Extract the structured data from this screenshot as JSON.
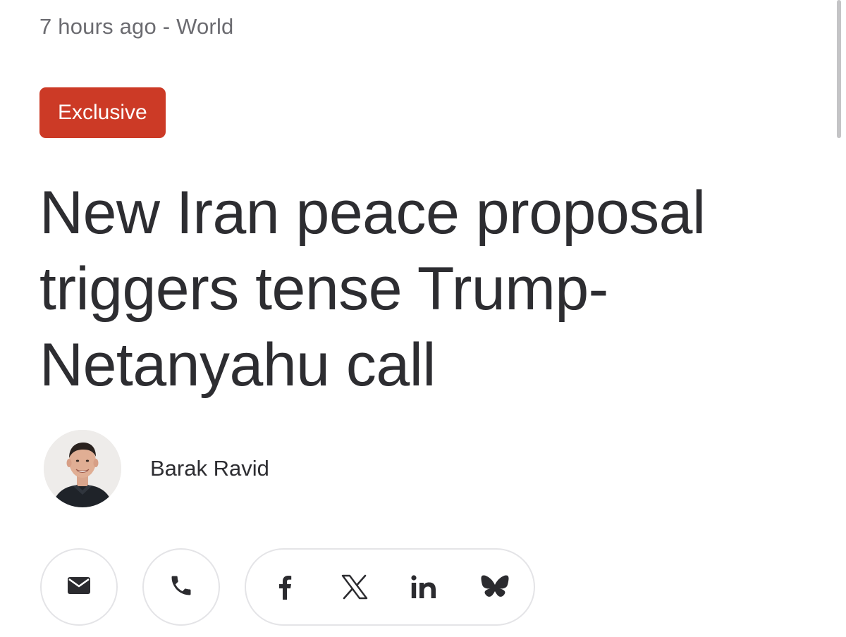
{
  "meta": {
    "time": "7 hours ago",
    "separator": " - ",
    "section": "World"
  },
  "badge": {
    "label": "Exclusive",
    "color": "#cc3a26"
  },
  "article": {
    "headline": "New Iran peace proposal triggers tense Trump-Netanyahu call"
  },
  "author": {
    "name": "Barak Ravid"
  },
  "share": {
    "buttons": [
      {
        "icon": "envelope-icon"
      },
      {
        "icon": "phone-icon"
      }
    ],
    "social": [
      {
        "icon": "facebook-icon"
      },
      {
        "icon": "x-icon"
      },
      {
        "icon": "linkedin-icon"
      },
      {
        "icon": "bluesky-icon"
      }
    ]
  }
}
